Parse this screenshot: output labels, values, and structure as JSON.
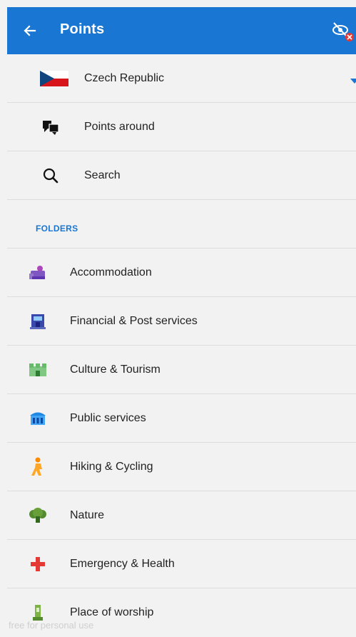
{
  "appbar": {
    "title": "Points",
    "back_icon": "arrow-left-icon",
    "visibility_icon": "eye-crossed-icon",
    "color": "#1976d2"
  },
  "top_items": [
    {
      "label": "Czech Republic",
      "icon": "czech-flag-icon"
    },
    {
      "label": "Points around",
      "icon": "points-around-icon"
    },
    {
      "label": "Search",
      "icon": "search-icon"
    }
  ],
  "folders_header": "FOLDERS",
  "folders": [
    {
      "label": "Accommodation",
      "icon": "accommodation-icon"
    },
    {
      "label": "Financial & Post services",
      "icon": "bank-icon"
    },
    {
      "label": "Culture & Tourism",
      "icon": "castle-icon"
    },
    {
      "label": "Public services",
      "icon": "public-building-icon"
    },
    {
      "label": "Hiking & Cycling",
      "icon": "hiker-icon"
    },
    {
      "label": "Nature",
      "icon": "tree-icon"
    },
    {
      "label": "Emergency & Health",
      "icon": "medical-cross-icon"
    },
    {
      "label": "Place of worship",
      "icon": "worship-icon"
    }
  ],
  "watermark": "free for personal use"
}
